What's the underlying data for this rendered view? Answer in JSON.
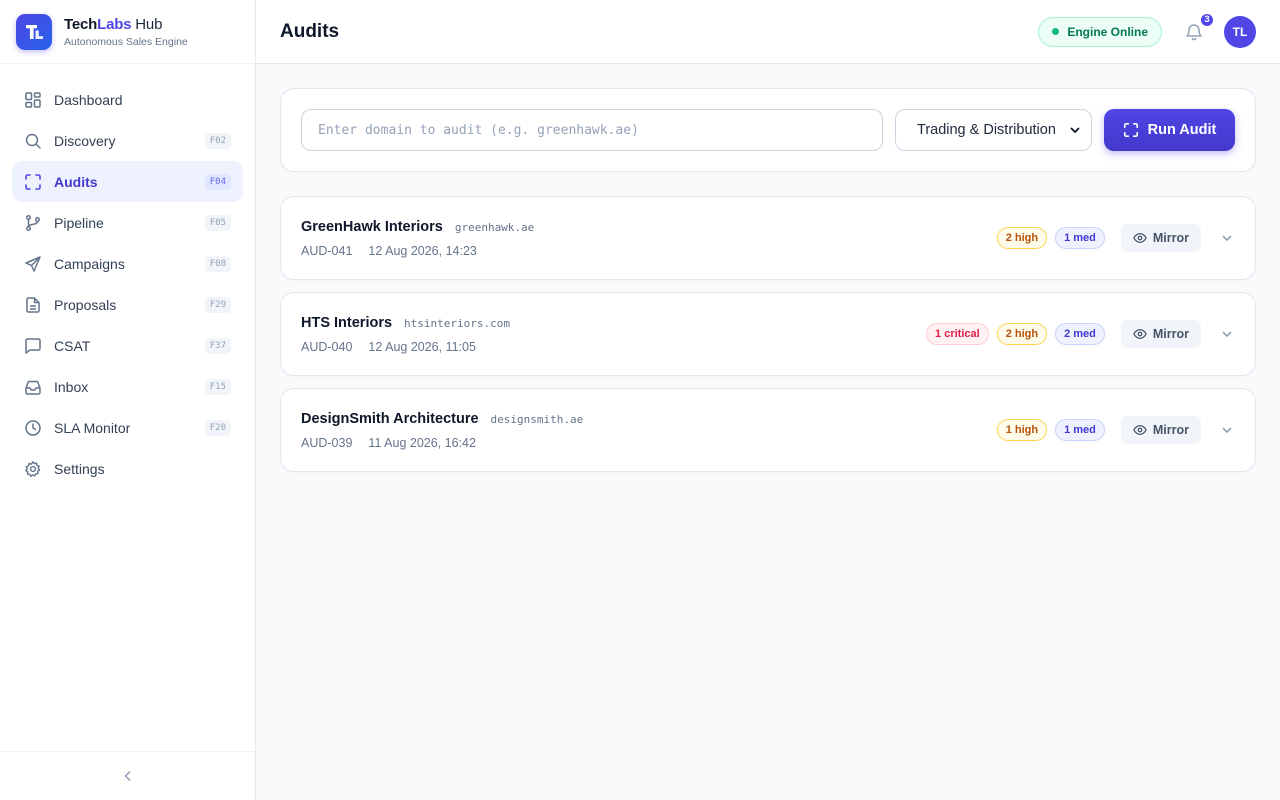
{
  "brand": {
    "name_part1": "Tech",
    "name_part2": "Labs",
    "name_part3": " Hub",
    "subtitle": "Autonomous Sales Engine",
    "logo_letters": "TL"
  },
  "sidebar": {
    "items": [
      {
        "label": "Dashboard",
        "key": "",
        "icon": "grid-icon",
        "active": false
      },
      {
        "label": "Discovery",
        "key": "F02",
        "icon": "search-icon",
        "active": false
      },
      {
        "label": "Audits",
        "key": "F04",
        "icon": "scan-icon",
        "active": true
      },
      {
        "label": "Pipeline",
        "key": "F05",
        "icon": "git-branch-icon",
        "active": false
      },
      {
        "label": "Campaigns",
        "key": "F08",
        "icon": "send-icon",
        "active": false
      },
      {
        "label": "Proposals",
        "key": "F29",
        "icon": "file-icon",
        "active": false
      },
      {
        "label": "CSAT",
        "key": "F37",
        "icon": "message-icon",
        "active": false
      },
      {
        "label": "Inbox",
        "key": "F15",
        "icon": "inbox-icon",
        "active": false
      },
      {
        "label": "SLA Monitor",
        "key": "F20",
        "icon": "clock-icon",
        "active": false
      },
      {
        "label": "Settings",
        "key": "",
        "icon": "gear-icon",
        "active": false
      }
    ],
    "collapse_icon": "chevron-left-icon"
  },
  "header": {
    "title": "Audits",
    "status": "Engine Online",
    "notifications": "3",
    "avatar": "TL"
  },
  "audit_form": {
    "placeholder": "Enter domain to audit (e.g. greenhawk.ae)",
    "value": "",
    "industry": "Trading & Distribution",
    "run_label": "Run Audit"
  },
  "audits": [
    {
      "company": "GreenHawk Interiors",
      "domain": "greenhawk.ae",
      "id": "AUD-041",
      "date": "12 Aug 2026, 14:23",
      "badges": [
        {
          "text": "2 high",
          "level": "high"
        },
        {
          "text": "1 med",
          "level": "med"
        }
      ],
      "mirror": "Mirror"
    },
    {
      "company": "HTS Interiors",
      "domain": "htsinteriors.com",
      "id": "AUD-040",
      "date": "12 Aug 2026, 11:05",
      "badges": [
        {
          "text": "1 critical",
          "level": "critical"
        },
        {
          "text": "2 high",
          "level": "high"
        },
        {
          "text": "2 med",
          "level": "med"
        }
      ],
      "mirror": "Mirror"
    },
    {
      "company": "DesignSmith Architecture",
      "domain": "designsmith.ae",
      "id": "AUD-039",
      "date": "11 Aug 2026, 16:42",
      "badges": [
        {
          "text": "1 high",
          "level": "high"
        },
        {
          "text": "1 med",
          "level": "med"
        }
      ],
      "mirror": "Mirror"
    }
  ],
  "colors": {
    "accent": "#4f46e5",
    "online": "#10b981",
    "critical": "#e11d48",
    "high": "#b45309",
    "med": "#4338ca"
  }
}
